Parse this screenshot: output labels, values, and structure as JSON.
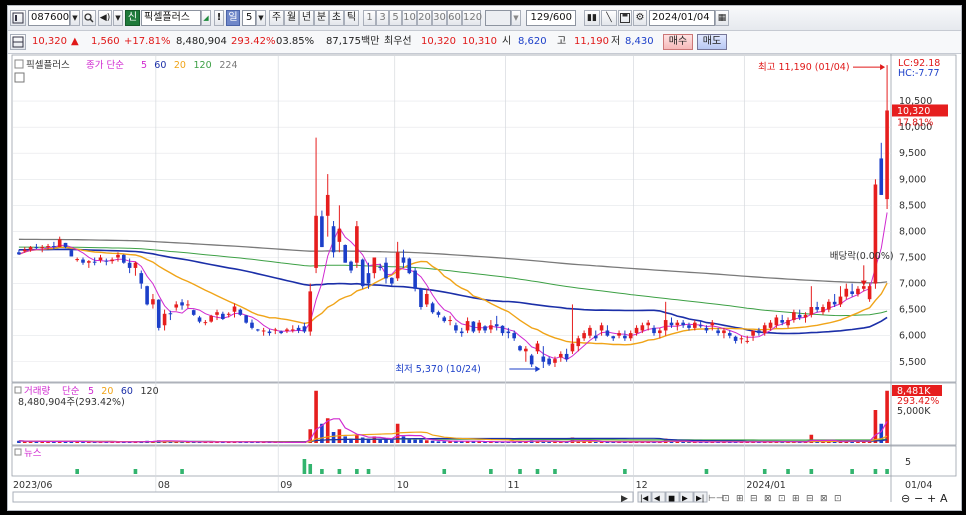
{
  "toolbar": {
    "code": "087600",
    "badge_new": "신",
    "stock_name": "픽셀플러스",
    "warn": "!",
    "period_selected": "일",
    "period_value": "5",
    "periods": [
      "주",
      "월",
      "년",
      "분",
      "초",
      "틱"
    ],
    "minute_steps": [
      "1",
      "3",
      "5",
      "10",
      "20",
      "30",
      "60",
      "120"
    ],
    "count": "129/600",
    "date": "2024/01/04"
  },
  "quote": {
    "price": "10,320",
    "arrow": "▲",
    "change": "1,560",
    "change_pct": "+17.81%",
    "volume": "8,480,904",
    "volume_ratio": "293.42%",
    "turnover": "03.85%",
    "amount": "87,175백만",
    "best_label": "최우선",
    "ask": "10,320",
    "bid": "10,310",
    "open_label": "시",
    "open": "8,620",
    "high_label": "고",
    "high": "11,190",
    "low_label": "저",
    "low": "8,430",
    "buy_label": "매수",
    "sell_label": "매도"
  },
  "legend": {
    "name": "픽셀플러스",
    "ma_label": "종가 단순",
    "ma_periods": [
      "5",
      "60",
      "20",
      "120",
      "224"
    ],
    "vol_label": "거래량",
    "vol_ma_label": "단순",
    "vol_ma_periods": [
      "5",
      "20",
      "60",
      "120"
    ],
    "vol_value": "8,480,904주(293.42%)",
    "news_label": "뉴스"
  },
  "annotations": {
    "high": "최고 11,190 (01/04)",
    "low": "최저 5,370 (10/24)",
    "dividend": "배당락(0.00%)"
  },
  "right_axis": {
    "lc": "LC:92.18",
    "hc": "HC:-7.77",
    "price_tag": "10,320",
    "pct_tag": "17.81%",
    "vol_tag": "8,481K",
    "vol_pct": "293.42%",
    "vol_tick": "5,000K",
    "news_tick": "5",
    "date_end": "01/04"
  },
  "colors": {
    "up": "#e61e1e",
    "down": "#1c3fc9",
    "ma5": "#d02ad0",
    "ma20": "#f0a418",
    "ma60": "#1b2fa8",
    "ma120": "#3da045",
    "ma224": "#7a7a7a",
    "news": "#32b46e"
  },
  "chart_data": {
    "type": "candlestick",
    "period": "daily",
    "y_ticks": [
      5500,
      6000,
      6500,
      7000,
      7500,
      8000,
      8500,
      9000,
      9500,
      10000,
      10500
    ],
    "y_tick_labels": [
      "5,500",
      "6,000",
      "6,500",
      "7,000",
      "7,500",
      "8,000",
      "8,500",
      "9,000",
      "9,500",
      "10,000",
      "10,500"
    ],
    "ylim": [
      5150,
      11250
    ],
    "month_labels": [
      "2023/06",
      "08",
      "09",
      "10",
      "11",
      "12",
      "2024/01"
    ],
    "month_start_index": [
      0,
      24,
      45,
      65,
      84,
      106,
      125
    ],
    "ohlc": [
      [
        7600,
        7650,
        7550,
        7560
      ],
      [
        7620,
        7700,
        7590,
        7650
      ],
      [
        7650,
        7720,
        7610,
        7700
      ],
      [
        7700,
        7760,
        7660,
        7680
      ],
      [
        7680,
        7740,
        7600,
        7700
      ],
      [
        7700,
        7760,
        7650,
        7720
      ],
      [
        7720,
        7800,
        7650,
        7700
      ],
      [
        7700,
        7900,
        7700,
        7850
      ],
      [
        7780,
        7780,
        7680,
        7700
      ],
      [
        7640,
        7650,
        7520,
        7520
      ],
      [
        7450,
        7500,
        7420,
        7470
      ],
      [
        7460,
        7500,
        7360,
        7400
      ],
      [
        7400,
        7450,
        7300,
        7430
      ],
      [
        7420,
        7500,
        7350,
        7400
      ],
      [
        7450,
        7550,
        7400,
        7500
      ],
      [
        7440,
        7480,
        7350,
        7420
      ],
      [
        7430,
        7500,
        7380,
        7460
      ],
      [
        7500,
        7600,
        7420,
        7550
      ],
      [
        7550,
        7560,
        7380,
        7400
      ],
      [
        7400,
        7480,
        7200,
        7300
      ],
      [
        7300,
        7420,
        7150,
        7400
      ],
      [
        7200,
        7250,
        6900,
        7000
      ],
      [
        6950,
        6960,
        6580,
        6600
      ],
      [
        6600,
        6800,
        6520,
        6700
      ],
      [
        6690,
        6700,
        6100,
        6150
      ],
      [
        6200,
        6500,
        6100,
        6420
      ],
      [
        6430,
        6480,
        6300,
        6420
      ],
      [
        6540,
        6660,
        6480,
        6600
      ],
      [
        6640,
        6700,
        6500,
        6580
      ],
      [
        6600,
        6680,
        6530,
        6600
      ],
      [
        6490,
        6500,
        6380,
        6400
      ],
      [
        6350,
        6380,
        6240,
        6270
      ],
      [
        6260,
        6300,
        6200,
        6260
      ],
      [
        6270,
        6400,
        6250,
        6380
      ],
      [
        6400,
        6500,
        6300,
        6450
      ],
      [
        6420,
        6460,
        6300,
        6320
      ],
      [
        6400,
        6450,
        6350,
        6420
      ],
      [
        6460,
        6620,
        6350,
        6560
      ],
      [
        6500,
        6520,
        6380,
        6400
      ],
      [
        6390,
        6400,
        6230,
        6250
      ],
      [
        6250,
        6310,
        6120,
        6150
      ],
      [
        6120,
        6130,
        6080,
        6100
      ],
      [
        6100,
        6150,
        6000,
        6100
      ],
      [
        6080,
        6120,
        6000,
        6050
      ],
      [
        6100,
        6150,
        6030,
        6120
      ],
      [
        6080,
        6100,
        6030,
        6050
      ],
      [
        6090,
        6150,
        6050,
        6120
      ],
      [
        6100,
        6200,
        6060,
        6120
      ],
      [
        6150,
        6200,
        6050,
        6100
      ],
      [
        6180,
        6250,
        6050,
        6080
      ],
      [
        6080,
        7000,
        6000,
        6850
      ],
      [
        7300,
        9800,
        7200,
        8300
      ],
      [
        8290,
        8400,
        7700,
        7700
      ],
      [
        8300,
        9100,
        7900,
        8700
      ],
      [
        8100,
        8200,
        7500,
        7600
      ],
      [
        7800,
        8500,
        7600,
        8050
      ],
      [
        7740,
        7750,
        7400,
        7400
      ],
      [
        7420,
        7440,
        7200,
        7250
      ],
      [
        7400,
        8200,
        7300,
        8100
      ],
      [
        7460,
        7480,
        6900,
        6950
      ],
      [
        7200,
        7400,
        6900,
        7000
      ],
      [
        7200,
        7500,
        7100,
        7500
      ],
      [
        7320,
        7380,
        7250,
        7300
      ],
      [
        7400,
        7500,
        7000,
        7100
      ],
      [
        7110,
        7120,
        6950,
        7000
      ],
      [
        7100,
        7800,
        7050,
        7600
      ],
      [
        7500,
        7650,
        7300,
        7400
      ],
      [
        7480,
        7500,
        7180,
        7200
      ],
      [
        7250,
        7300,
        6850,
        6900
      ],
      [
        6900,
        6920,
        6500,
        6550
      ],
      [
        6600,
        6900,
        6550,
        6800
      ],
      [
        6620,
        6650,
        6420,
        6450
      ],
      [
        6450,
        6480,
        6350,
        6400
      ],
      [
        6350,
        6380,
        6250,
        6280
      ],
      [
        6300,
        6380,
        6200,
        6300
      ],
      [
        6200,
        6250,
        6050,
        6100
      ],
      [
        6080,
        6150,
        5980,
        6050
      ],
      [
        6100,
        6350,
        6050,
        6280
      ],
      [
        6270,
        6280,
        6050,
        6080
      ],
      [
        6100,
        6300,
        6050,
        6250
      ],
      [
        6180,
        6200,
        6050,
        6100
      ],
      [
        6120,
        6300,
        6050,
        6200
      ],
      [
        6220,
        6380,
        6100,
        6180
      ],
      [
        6190,
        6200,
        6000,
        6050
      ],
      [
        6080,
        6150,
        5950,
        6050
      ],
      [
        6050,
        6100,
        5900,
        5950
      ],
      [
        5800,
        5820,
        5700,
        5720
      ],
      [
        5700,
        5800,
        5500,
        5750
      ],
      [
        5620,
        5650,
        5400,
        5450
      ],
      [
        5700,
        5900,
        5650,
        5850
      ],
      [
        5600,
        5800,
        5380,
        5500
      ],
      [
        5560,
        5600,
        5420,
        5450
      ],
      [
        5480,
        5600,
        5400,
        5550
      ],
      [
        5580,
        5700,
        5500,
        5650
      ],
      [
        5650,
        5750,
        5500,
        5550
      ],
      [
        5700,
        6600,
        5650,
        5850
      ],
      [
        5800,
        6000,
        5700,
        5950
      ],
      [
        5950,
        6100,
        5900,
        6050
      ],
      [
        6000,
        6200,
        5950,
        6150
      ],
      [
        6000,
        6100,
        5900,
        5950
      ],
      [
        6100,
        6250,
        6000,
        6200
      ],
      [
        6100,
        6200,
        5980,
        6000
      ],
      [
        5990,
        6000,
        5900,
        5950
      ],
      [
        6000,
        6100,
        5950,
        6050
      ],
      [
        6000,
        6100,
        5900,
        5950
      ],
      [
        5950,
        6100,
        5900,
        6050
      ],
      [
        6050,
        6200,
        6000,
        6150
      ],
      [
        6100,
        6250,
        6050,
        6200
      ],
      [
        6200,
        6300,
        6100,
        6250
      ],
      [
        6150,
        6200,
        6000,
        6050
      ],
      [
        6050,
        6150,
        5950,
        6100
      ],
      [
        6100,
        6650,
        6000,
        6300
      ],
      [
        6250,
        6350,
        6150,
        6200
      ],
      [
        6200,
        6300,
        6100,
        6250
      ],
      [
        6250,
        6300,
        6150,
        6200
      ],
      [
        6200,
        6250,
        6100,
        6150
      ],
      [
        6150,
        6300,
        6100,
        6250
      ],
      [
        6200,
        6300,
        6150,
        6180
      ],
      [
        6150,
        6200,
        6050,
        6100
      ],
      [
        6200,
        6300,
        6100,
        6250
      ],
      [
        6100,
        6150,
        6000,
        6050
      ],
      [
        6050,
        6150,
        5950,
        6100
      ],
      [
        6050,
        6100,
        5950,
        6000
      ],
      [
        5980,
        6000,
        5850,
        5900
      ],
      [
        5950,
        6000,
        5850,
        5950
      ],
      [
        5900,
        6000,
        5850,
        5900
      ],
      [
        6000,
        6100,
        5900,
        6100
      ],
      [
        6100,
        6150,
        6000,
        6050
      ],
      [
        6050,
        6250,
        6000,
        6200
      ],
      [
        6150,
        6300,
        6100,
        6250
      ],
      [
        6200,
        6400,
        6150,
        6350
      ],
      [
        6300,
        6400,
        6200,
        6250
      ],
      [
        6200,
        6350,
        6150,
        6300
      ],
      [
        6300,
        6500,
        6250,
        6450
      ],
      [
        6400,
        6500,
        6300,
        6350
      ],
      [
        6350,
        6450,
        6250,
        6400
      ],
      [
        6400,
        6950,
        6350,
        6550
      ],
      [
        6550,
        6650,
        6450,
        6500
      ],
      [
        6450,
        6600,
        6400,
        6550
      ],
      [
        6500,
        6700,
        6450,
        6650
      ],
      [
        6650,
        6800,
        6550,
        6600
      ],
      [
        6600,
        6950,
        6550,
        6750
      ],
      [
        6750,
        7000,
        6700,
        6900
      ],
      [
        6850,
        7000,
        6750,
        6800
      ],
      [
        6800,
        6950,
        6750,
        6900
      ],
      [
        6900,
        7000,
        6850,
        6950
      ],
      [
        6700,
        7000,
        6650,
        6950
      ],
      [
        7000,
        9000,
        6900,
        8900
      ],
      [
        9400,
        9700,
        8700,
        8700
      ],
      [
        8620,
        11190,
        8430,
        10320
      ]
    ],
    "volume_ratio": [
      0.04,
      0.03,
      0.03,
      0.03,
      0.02,
      0.03,
      0.03,
      0.04,
      0.03,
      0.03,
      0.02,
      0.02,
      0.02,
      0.02,
      0.02,
      0.02,
      0.02,
      0.02,
      0.02,
      0.02,
      0.02,
      0.03,
      0.04,
      0.03,
      0.05,
      0.04,
      0.03,
      0.03,
      0.02,
      0.02,
      0.02,
      0.02,
      0.02,
      0.02,
      0.02,
      0.02,
      0.02,
      0.02,
      0.02,
      0.02,
      0.02,
      0.02,
      0.01,
      0.01,
      0.01,
      0.01,
      0.01,
      0.01,
      0.01,
      0.01,
      0.25,
      0.95,
      0.35,
      0.45,
      0.2,
      0.25,
      0.12,
      0.08,
      0.15,
      0.1,
      0.08,
      0.12,
      0.06,
      0.08,
      0.06,
      0.35,
      0.12,
      0.08,
      0.06,
      0.06,
      0.05,
      0.04,
      0.03,
      0.03,
      0.03,
      0.04,
      0.03,
      0.03,
      0.03,
      0.03,
      0.02,
      0.02,
      0.02,
      0.02,
      0.02,
      0.02,
      0.04,
      0.03,
      0.05,
      0.04,
      0.03,
      0.02,
      0.02,
      0.02,
      0.02,
      0.1,
      0.04,
      0.03,
      0.03,
      0.02,
      0.02,
      0.02,
      0.02,
      0.02,
      0.02,
      0.02,
      0.02,
      0.02,
      0.02,
      0.02,
      0.02,
      0.08,
      0.02,
      0.02,
      0.02,
      0.02,
      0.02,
      0.02,
      0.02,
      0.02,
      0.02,
      0.02,
      0.02,
      0.02,
      0.02,
      0.02,
      0.02,
      0.02,
      0.02,
      0.03,
      0.03,
      0.02,
      0.02,
      0.02,
      0.02,
      0.02,
      0.15,
      0.02,
      0.02,
      0.03,
      0.03,
      0.05,
      0.04,
      0.03,
      0.03,
      0.03,
      0.03,
      0.6,
      0.35,
      0.95
    ],
    "news": [
      [
        10,
        1
      ],
      [
        20,
        1
      ],
      [
        28,
        1
      ],
      [
        49,
        3
      ],
      [
        50,
        2
      ],
      [
        52,
        1
      ],
      [
        55,
        1
      ],
      [
        58,
        1
      ],
      [
        60,
        1
      ],
      [
        73,
        1
      ],
      [
        81,
        1
      ],
      [
        86,
        1
      ],
      [
        89,
        1
      ],
      [
        92,
        1
      ],
      [
        104,
        1
      ],
      [
        118,
        1
      ],
      [
        128,
        1
      ],
      [
        132,
        1
      ],
      [
        136,
        1
      ],
      [
        143,
        1
      ],
      [
        147,
        1
      ],
      [
        149,
        1
      ]
    ]
  }
}
